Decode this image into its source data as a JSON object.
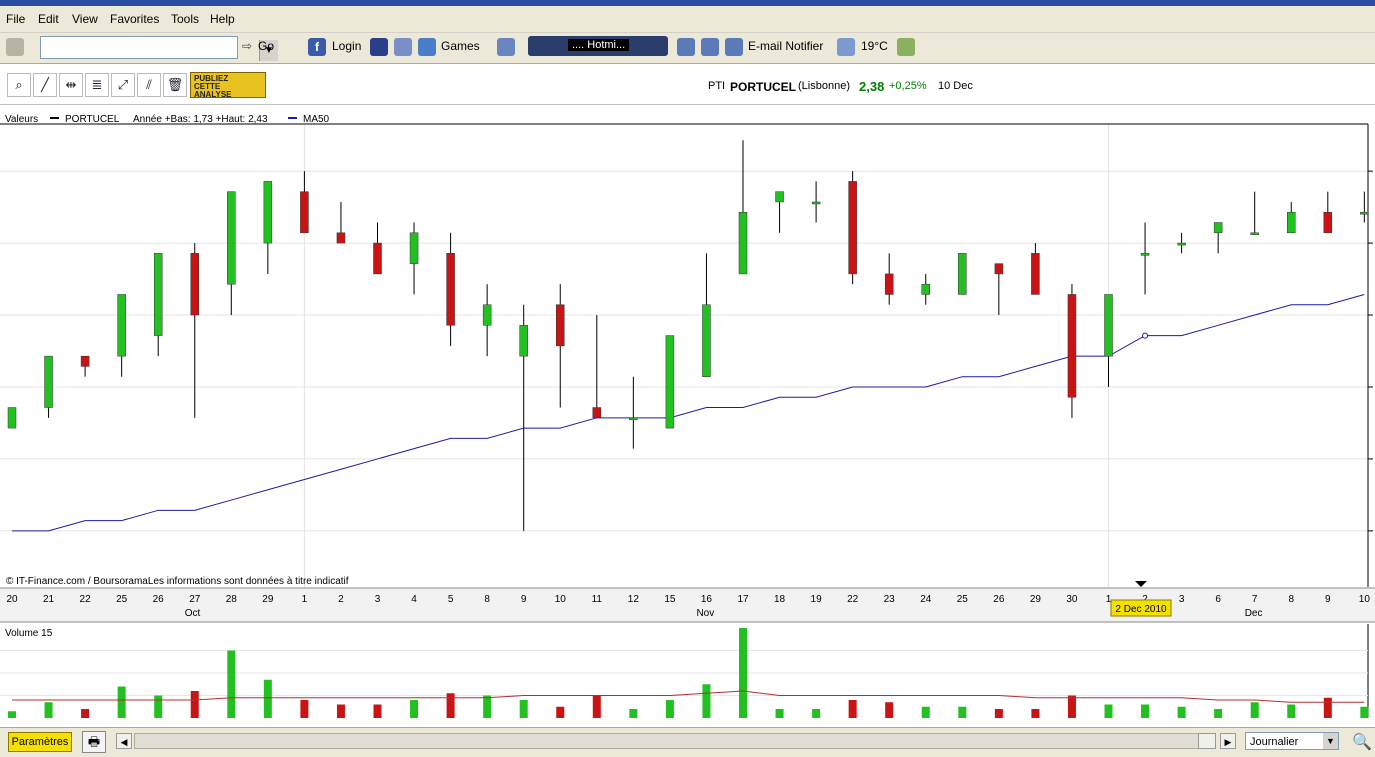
{
  "menu": [
    "File",
    "Edit",
    "View",
    "Favorites",
    "Tools",
    "Help"
  ],
  "toolbar": {
    "go_label": "Go",
    "login_label": "Login",
    "games_label": "Games",
    "hotmail_label": ".... Hotmi...",
    "email_label": "E-mail Notifier",
    "temp_label": "19°C"
  },
  "quote": {
    "code": "PTI",
    "name": "PORTUCEL",
    "market": "(Lisbonne)",
    "price": "2,38",
    "change": "+0,25%",
    "date": "10 Dec",
    "change_color": "#008000"
  },
  "publiez": {
    "line1": "PUBLIEZ",
    "line2": "CETTE",
    "line3": "ANALYSE"
  },
  "legend": {
    "valeurs": "Valeurs",
    "series": "PORTUCEL",
    "range": "Année +Bas: 1,73 +Haut: 2,43",
    "ma": "MA50"
  },
  "credit": "© IT-Finance.com / BoursoramaLes informations sont données à titre indicatif",
  "volume_title": "Volume 15",
  "cursor_label": "2 Dec 2010",
  "params_label": "Paramètres",
  "period_label": "Journalier",
  "colors": {
    "up": "#22c020",
    "down": "#c81414",
    "ma": "#1c1ca0",
    "volma": "#b03030"
  },
  "chart_data": {
    "type": "candlestick",
    "x": [
      "20",
      "21",
      "22",
      "25",
      "26",
      "27",
      "28",
      "29",
      "1",
      "2",
      "3",
      "4",
      "5",
      "8",
      "9",
      "10",
      "11",
      "12",
      "15",
      "16",
      "17",
      "18",
      "19",
      "22",
      "23",
      "24",
      "25",
      "26",
      "29",
      "30",
      "1",
      "2",
      "3",
      "6",
      "7",
      "8",
      "9",
      "10"
    ],
    "month_labels": [
      {
        "label": "Oct",
        "at": "27"
      },
      {
        "label": "Nov",
        "at": "16"
      },
      {
        "label": "Dec",
        "at": "7"
      }
    ],
    "ohlc": [
      [
        2.07,
        2.09,
        2.07,
        2.09
      ],
      [
        2.09,
        2.14,
        2.08,
        2.14
      ],
      [
        2.14,
        2.14,
        2.12,
        2.13
      ],
      [
        2.14,
        2.18,
        2.12,
        2.2
      ],
      [
        2.16,
        2.22,
        2.14,
        2.24
      ],
      [
        2.24,
        2.25,
        2.08,
        2.18
      ],
      [
        2.21,
        2.26,
        2.18,
        2.3
      ],
      [
        2.25,
        2.28,
        2.22,
        2.31
      ],
      [
        2.3,
        2.32,
        2.26,
        2.26
      ],
      [
        2.26,
        2.29,
        2.25,
        2.25
      ],
      [
        2.25,
        2.27,
        2.22,
        2.22
      ],
      [
        2.23,
        2.27,
        2.2,
        2.26
      ],
      [
        2.24,
        2.26,
        2.15,
        2.17
      ],
      [
        2.17,
        2.21,
        2.14,
        2.19
      ],
      [
        2.14,
        2.19,
        1.97,
        2.17
      ],
      [
        2.19,
        2.21,
        2.09,
        2.15
      ],
      [
        2.09,
        2.18,
        2.08,
        2.08
      ],
      [
        2.08,
        2.12,
        2.05,
        2.08
      ],
      [
        2.07,
        2.15,
        2.07,
        2.16
      ],
      [
        2.12,
        2.24,
        2.12,
        2.19
      ],
      [
        2.22,
        2.35,
        2.22,
        2.28
      ],
      [
        2.29,
        2.29,
        2.26,
        2.3
      ],
      [
        2.29,
        2.31,
        2.27,
        2.29
      ],
      [
        2.31,
        2.32,
        2.21,
        2.22
      ],
      [
        2.22,
        2.24,
        2.19,
        2.2
      ],
      [
        2.2,
        2.22,
        2.19,
        2.21
      ],
      [
        2.2,
        2.24,
        2.2,
        2.24
      ],
      [
        2.23,
        2.23,
        2.18,
        2.22
      ],
      [
        2.24,
        2.25,
        2.2,
        2.2
      ],
      [
        2.2,
        2.21,
        2.08,
        2.1
      ],
      [
        2.14,
        2.2,
        2.11,
        2.2
      ],
      [
        2.24,
        2.27,
        2.2,
        2.24
      ],
      [
        2.25,
        2.26,
        2.24,
        2.25
      ],
      [
        2.26,
        2.27,
        2.24,
        2.27
      ],
      [
        2.26,
        2.3,
        2.26,
        2.26
      ],
      [
        2.26,
        2.29,
        2.26,
        2.28
      ],
      [
        2.28,
        2.3,
        2.26,
        2.26
      ],
      [
        2.28,
        2.3,
        2.27,
        2.28
      ]
    ],
    "ma50": [
      1.97,
      1.97,
      1.98,
      1.98,
      1.99,
      1.99,
      2.0,
      2.01,
      2.02,
      2.03,
      2.04,
      2.05,
      2.06,
      2.06,
      2.07,
      2.07,
      2.08,
      2.08,
      2.08,
      2.09,
      2.09,
      2.1,
      2.1,
      2.11,
      2.11,
      2.11,
      2.12,
      2.12,
      2.13,
      2.14,
      2.14,
      2.16,
      2.16,
      2.17,
      2.18,
      2.19,
      2.19,
      2.2
    ],
    "volume": [
      3,
      7,
      4,
      14,
      10,
      12,
      30,
      17,
      8,
      6,
      6,
      8,
      11,
      10,
      8,
      5,
      10,
      4,
      8,
      15,
      40,
      4,
      4,
      8,
      7,
      5,
      5,
      4,
      4,
      10,
      6,
      6,
      5,
      4,
      7,
      6,
      9,
      5
    ],
    "volume_ma": [
      8,
      8,
      8,
      8,
      8,
      8,
      9,
      9,
      9,
      9,
      9,
      9,
      9,
      9,
      10,
      10,
      10,
      10,
      10,
      11,
      12,
      10,
      10,
      10,
      10,
      10,
      10,
      10,
      9,
      9,
      9,
      9,
      9,
      8,
      8,
      7,
      7,
      7
    ],
    "ylim": [
      1.93,
      2.36
    ],
    "xlabel": "",
    "ylabel": ""
  }
}
